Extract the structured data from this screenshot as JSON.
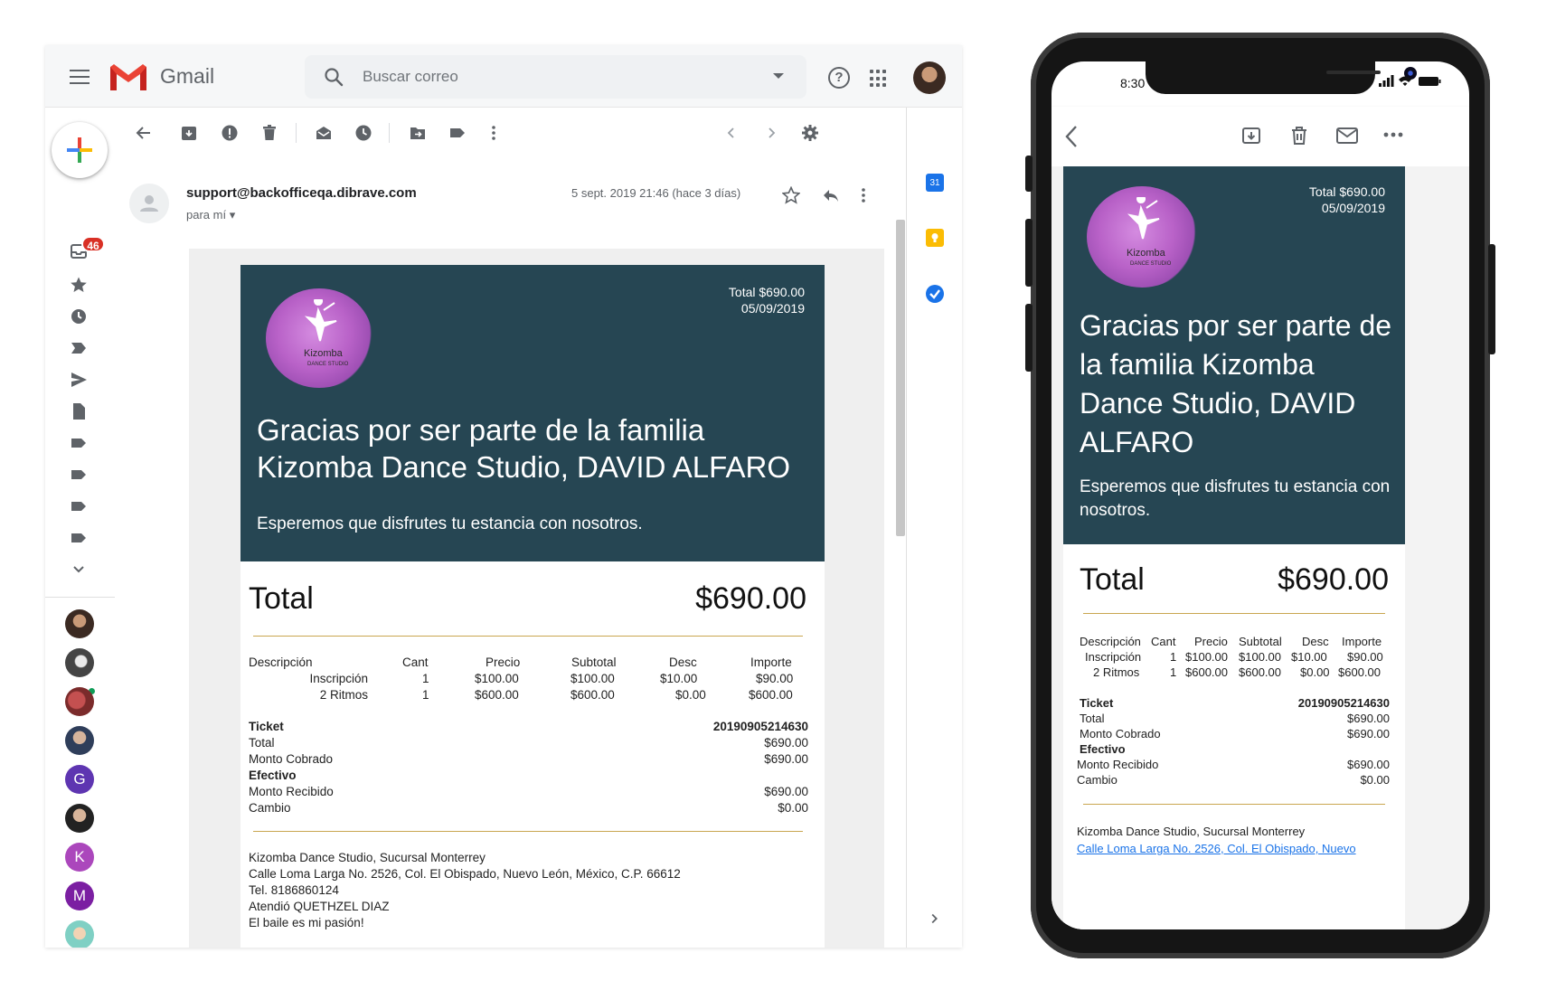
{
  "gmail": {
    "app_name": "Gmail",
    "search_placeholder": "Buscar correo",
    "help_glyph": "?",
    "inbox_badge": "46",
    "hangouts_letters": [
      "G",
      "K",
      "M"
    ],
    "calendar_day": "31",
    "message": {
      "sender": "support@backofficeqa.dibrave.com",
      "to": "para mí",
      "date": "5 sept. 2019 21:46 (hace 3 días)"
    }
  },
  "email": {
    "brand_line1": "Kizomba",
    "brand_line2": "DANCE STUDIO",
    "header_total": "Total $690.00",
    "header_date": "05/09/2019",
    "title": "Gracias por ser parte de la familia Kizomba Dance Studio, DAVID ALFARO",
    "subtitle": "Esperemos que disfrutes tu estancia con nosotros.",
    "total_label": "Total",
    "total_value": "$690.00",
    "columns": [
      "Descripción",
      "Cant",
      "Precio",
      "Subtotal",
      "Desc",
      "Importe"
    ],
    "rows": [
      [
        "Inscripción",
        "1",
        "$100.00",
        "$100.00",
        "$10.00",
        "$90.00"
      ],
      [
        "2 Ritmos",
        "1",
        "$600.00",
        "$600.00",
        "$0.00",
        "$600.00"
      ]
    ],
    "ticket_label": "Ticket",
    "ticket_number": "20190905214630",
    "summary": [
      {
        "label": "Total",
        "value": "$690.00"
      },
      {
        "label": "Monto Cobrado",
        "value": "$690.00"
      }
    ],
    "payment_method": "Efectivo",
    "payment": [
      {
        "label": "Monto Recibido",
        "value": "$690.00"
      },
      {
        "label": "Cambio",
        "value": "$0.00"
      }
    ],
    "footer": {
      "branch": "Kizomba Dance Studio, Sucursal Monterrey",
      "address": "Calle Loma Larga No. 2526, Col. El Obispado, Nuevo León, México, C.P. 66612",
      "phone": "Tel. 8186860124",
      "attended": "Atendió QUETHZEL DIAZ",
      "motto": "El baile es mi pasión!"
    }
  },
  "phone": {
    "time": "8:30",
    "title_lines": [
      "Gracias por ser parte de",
      "la familia Kizomba",
      "Dance Studio, DAVID",
      "ALFARO"
    ],
    "subtitle_lines": [
      "Esperemos que disfrutes tu estancia con",
      "nosotros."
    ],
    "address_link": "Calle Loma Larga No. 2526, Col. El Obispado, Nuevo"
  },
  "colors": {
    "hero_bg": "#264653",
    "gold_rule": "#c9a650",
    "gmail_red": "#d93025",
    "link_blue": "#1a73e8"
  },
  "icons": [
    "menu-icon",
    "gmail-logo-icon",
    "search-icon",
    "help-icon",
    "apps-icon",
    "compose-plus-icon",
    "back-arrow-icon",
    "archive-icon",
    "spam-icon",
    "delete-icon",
    "mark-unread-icon",
    "snooze-icon",
    "move-to-icon",
    "label-icon",
    "more-vert-icon",
    "chevron-left-icon",
    "chevron-right-icon",
    "settings-icon",
    "star-icon",
    "reply-icon",
    "calendar-icon",
    "keep-icon",
    "tasks-icon",
    "mail-icon"
  ]
}
